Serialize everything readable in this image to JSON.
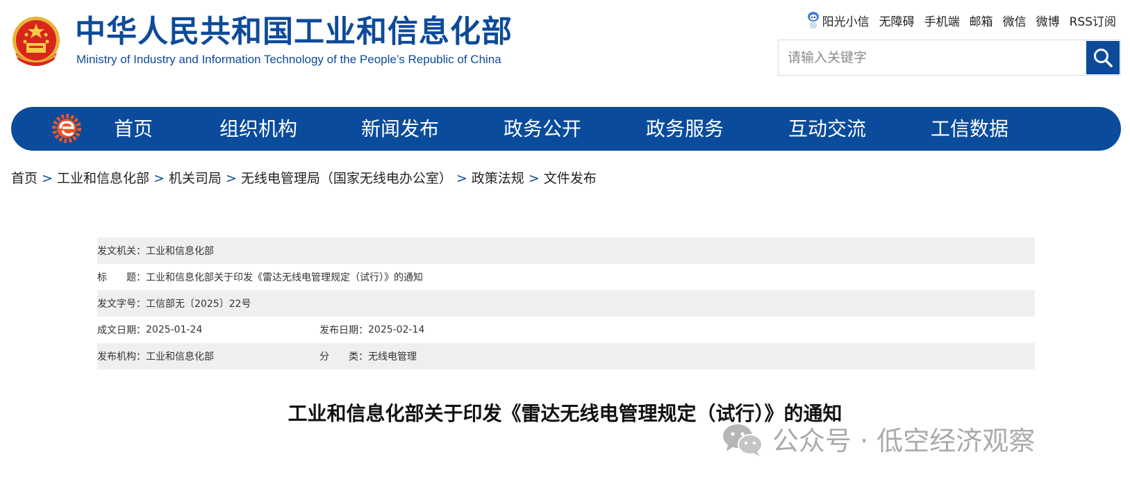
{
  "header": {
    "title": "中华人民共和国工业和信息化部",
    "subtitle": "Ministry of Industry and Information Technology of the People’s Republic of China"
  },
  "top_links": [
    "阳光小信",
    "无障碍",
    "手机端",
    "邮箱",
    "微信",
    "微博",
    "RSS订阅"
  ],
  "search": {
    "placeholder": "请输入关键字"
  },
  "colors": {
    "brand": "#0a4b9b",
    "row_shade": "#efefef"
  },
  "nav": [
    "首页",
    "组织机构",
    "新闻发布",
    "政务公开",
    "政务服务",
    "互动交流",
    "工信数据"
  ],
  "breadcrumb": [
    "首页",
    "工业和信息化部",
    "机关司局",
    "无线电管理局（国家无线电办公室）",
    "政策法规",
    "文件发布"
  ],
  "breadcrumb_separator": ">",
  "doc_info": {
    "issuer_label": "发文机关：",
    "issuer": "工业和信息化部",
    "title_label": "标　　题：",
    "title": "工业和信息化部关于印发《雷达无线电管理规定（试行）》的通知",
    "doc_no_label": "发文字号：",
    "doc_no": "工信部无〔2025〕22号",
    "written_date_label": "成文日期：",
    "written_date": "2025-01-24",
    "published_date_label": "发布日期：",
    "published_date": "2025-02-14",
    "publisher_label": "发布机构：",
    "publisher": "工业和信息化部",
    "category_label": "分　　类：",
    "category": "无线电管理"
  },
  "article": {
    "title": "工业和信息化部关于印发《雷达无线电管理规定（试行）》的通知"
  },
  "watermark": {
    "text": "公众号 · 低空经济观察"
  }
}
